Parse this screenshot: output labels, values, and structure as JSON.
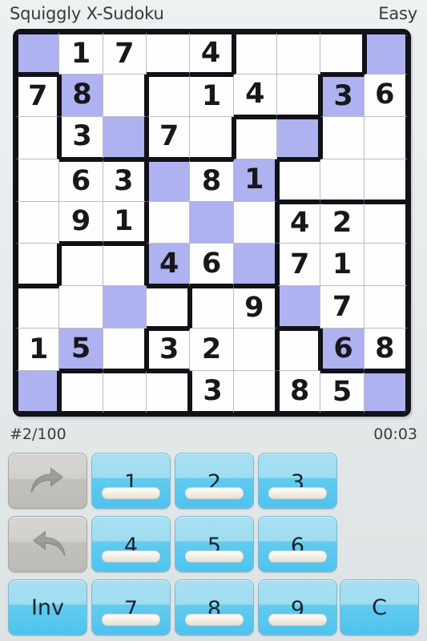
{
  "header": {
    "title": "Squiggly X-Sudoku",
    "difficulty": "Easy"
  },
  "status": {
    "puzzle_number": "#2/100",
    "timer": "00:03"
  },
  "colors": {
    "highlight": "#aeb2f0",
    "key_fill_top": "#a8e0f2",
    "key_fill_bottom": "#4ec3ee",
    "key_disabled": "#d2d0cc",
    "grid_line": "#b9bcc2",
    "region_line": "#111118",
    "background": "#e4e9ea"
  },
  "board": {
    "rows": 9,
    "cols": 9,
    "values": [
      [
        "",
        "1",
        "7",
        "",
        "4",
        "",
        "",
        "",
        ""
      ],
      [
        "7",
        "8",
        "",
        "",
        "1",
        "4",
        "",
        "3",
        "6"
      ],
      [
        "",
        "3",
        "",
        "7",
        "",
        "",
        "",
        "",
        ""
      ],
      [
        "",
        "6",
        "3",
        "",
        "8",
        "1",
        "",
        "",
        ""
      ],
      [
        "",
        "9",
        "1",
        "",
        "",
        "",
        "4",
        "2",
        ""
      ],
      [
        "",
        "",
        "",
        "4",
        "6",
        "",
        "7",
        "1",
        ""
      ],
      [
        "",
        "",
        "",
        "",
        "",
        "9",
        "",
        "7",
        ""
      ],
      [
        "1",
        "5",
        "",
        "3",
        "2",
        "",
        "",
        "6",
        "8"
      ],
      [
        "",
        "",
        "",
        "",
        "3",
        "",
        "8",
        "5",
        ""
      ]
    ],
    "highlighted": [
      [
        1,
        0,
        0,
        0,
        0,
        0,
        0,
        0,
        1
      ],
      [
        0,
        1,
        0,
        0,
        0,
        0,
        0,
        1,
        0
      ],
      [
        0,
        0,
        1,
        0,
        0,
        0,
        1,
        0,
        0
      ],
      [
        0,
        0,
        0,
        1,
        0,
        1,
        0,
        0,
        0
      ],
      [
        0,
        0,
        0,
        0,
        1,
        0,
        0,
        0,
        0
      ],
      [
        0,
        0,
        0,
        1,
        0,
        1,
        0,
        0,
        0
      ],
      [
        0,
        0,
        1,
        0,
        0,
        0,
        1,
        0,
        0
      ],
      [
        0,
        1,
        0,
        0,
        0,
        0,
        0,
        1,
        0
      ],
      [
        1,
        0,
        0,
        0,
        0,
        0,
        0,
        0,
        1
      ]
    ],
    "regions": [
      [
        0,
        0,
        0,
        0,
        0,
        1,
        1,
        1,
        2
      ],
      [
        3,
        0,
        0,
        1,
        1,
        1,
        1,
        2,
        2
      ],
      [
        3,
        0,
        0,
        1,
        1,
        4,
        4,
        2,
        2
      ],
      [
        3,
        3,
        3,
        4,
        4,
        4,
        2,
        2,
        2
      ],
      [
        3,
        3,
        3,
        4,
        4,
        4,
        5,
        5,
        5
      ],
      [
        3,
        6,
        6,
        4,
        4,
        4,
        5,
        5,
        5
      ],
      [
        6,
        6,
        6,
        6,
        7,
        7,
        5,
        5,
        5
      ],
      [
        6,
        6,
        6,
        7,
        7,
        7,
        8,
        5,
        5
      ],
      [
        6,
        8,
        8,
        8,
        7,
        7,
        8,
        8,
        8
      ]
    ]
  },
  "keypad": {
    "undo_icon": "undo-arrow-icon",
    "redo_icon": "redo-arrow-icon",
    "inv_label": "Inv",
    "clear_label": "C",
    "digits": [
      "1",
      "2",
      "3",
      "4",
      "5",
      "6",
      "7",
      "8",
      "9"
    ]
  }
}
